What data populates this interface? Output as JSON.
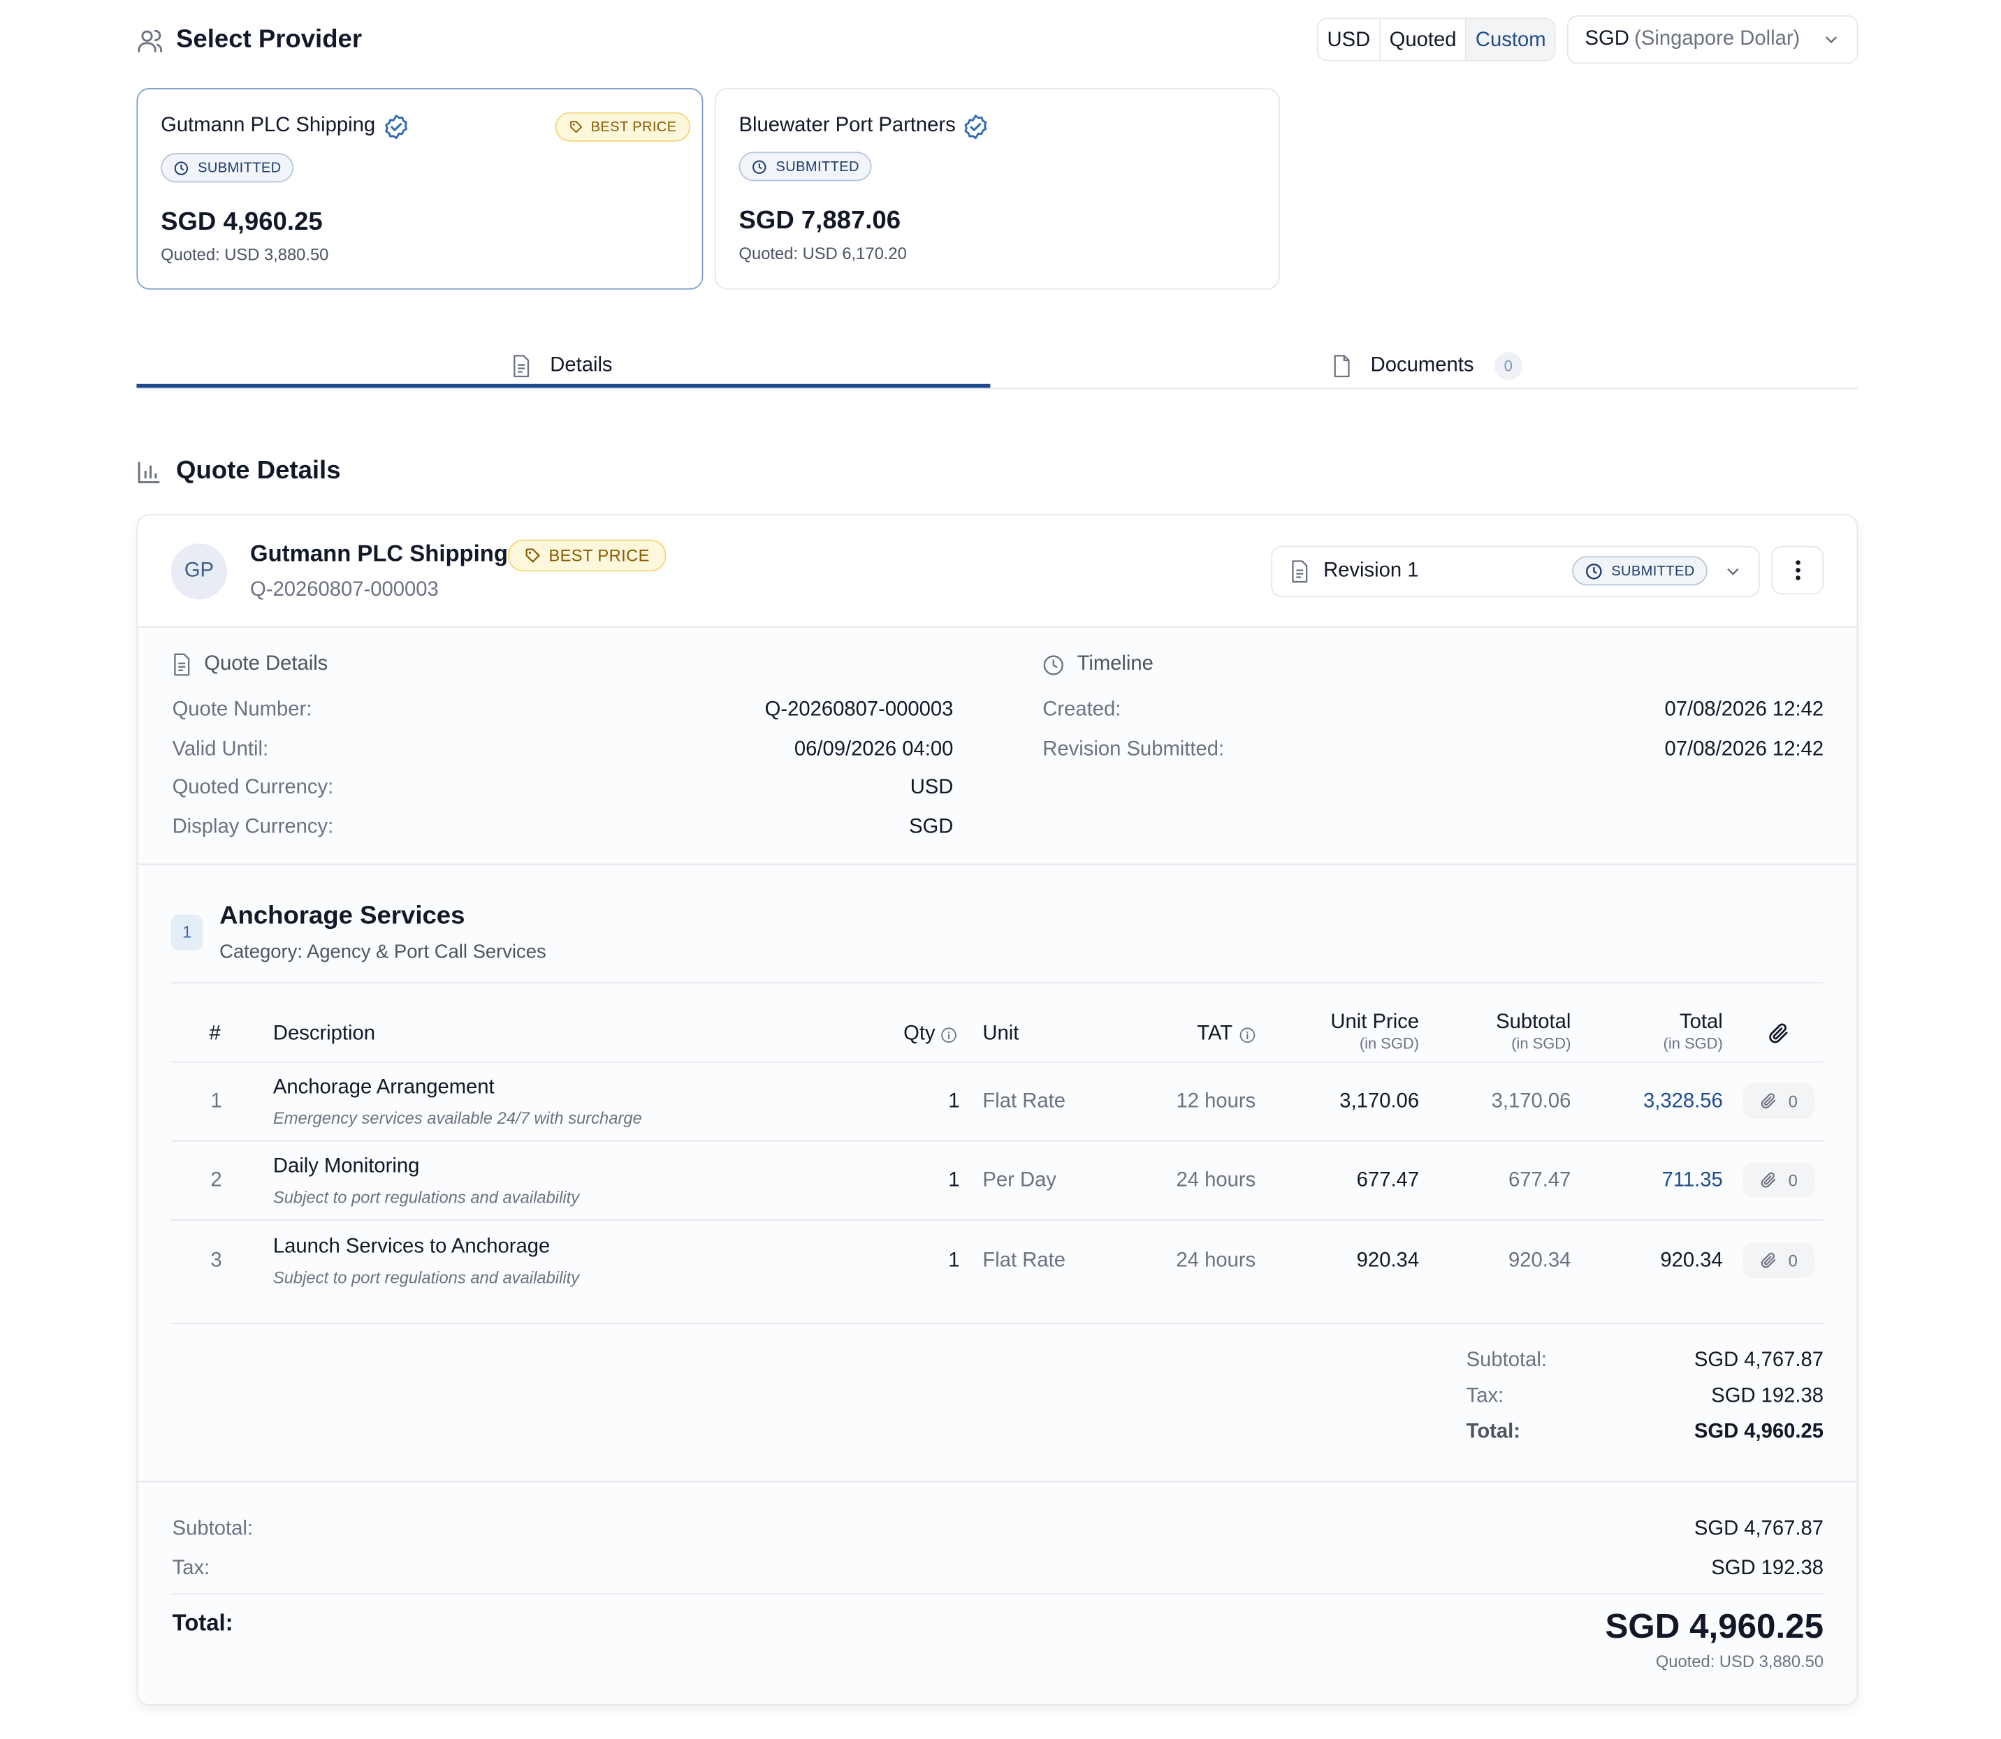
{
  "header": {
    "title": "Select Provider",
    "currency_modes": [
      "USD",
      "Quoted",
      "Custom"
    ],
    "currency_code": "SGD",
    "currency_name": "(Singapore Dollar)"
  },
  "providers": [
    {
      "name": "Gutmann PLC Shipping",
      "status": "SUBMITTED",
      "badge": "BEST PRICE",
      "amount": "SGD 4,960.25",
      "quoted": "Quoted: USD 3,880.50"
    },
    {
      "name": "Bluewater Port Partners",
      "status": "SUBMITTED",
      "amount": "SGD 7,887.06",
      "quoted": "Quoted: USD 6,170.20"
    }
  ],
  "tabs": [
    {
      "label": "Details"
    },
    {
      "label": "Documents",
      "count": "0"
    }
  ],
  "section_title": "Quote Details",
  "quote": {
    "avatar": "GP",
    "provider_name": "Gutmann PLC Shipping",
    "badge": "BEST PRICE",
    "number": "Q-20260807-000003",
    "revision": "Revision 1",
    "revision_status": "SUBMITTED",
    "details": {
      "heading": "Quote Details",
      "rows": [
        {
          "label": "Quote Number:",
          "value": "Q-20260807-000003"
        },
        {
          "label": "Valid Until:",
          "value": "06/09/2026 04:00"
        },
        {
          "label": "Quoted Currency:",
          "value": "USD"
        },
        {
          "label": "Display Currency:",
          "value": "SGD"
        }
      ]
    },
    "timeline": {
      "heading": "Timeline",
      "rows": [
        {
          "label": "Created:",
          "value": "07/08/2026 12:42"
        },
        {
          "label": "Revision Submitted:",
          "value": "07/08/2026 12:42"
        }
      ]
    },
    "service": {
      "index": "1",
      "title": "Anchorage Services",
      "category": "Category: Agency & Port Call Services",
      "columns": {
        "num": "#",
        "desc": "Description",
        "qty": "Qty",
        "unit": "Unit",
        "tat": "TAT",
        "unit_price": "Unit Price",
        "subtotal": "Subtotal",
        "total": "Total",
        "in_sgd": "(in SGD)"
      },
      "rows": [
        {
          "num": "1",
          "title": "Anchorage Arrangement",
          "note": "Emergency services available 24/7 with surcharge",
          "qty": "1",
          "unit": "Flat Rate",
          "tat": "12 hours",
          "unit_price": "3,170.06",
          "subtotal": "3,170.06",
          "total": "3,328.56",
          "attachments": "0"
        },
        {
          "num": "2",
          "title": "Daily Monitoring",
          "note": "Subject to port regulations and availability",
          "qty": "1",
          "unit": "Per Day",
          "tat": "24 hours",
          "unit_price": "677.47",
          "subtotal": "677.47",
          "total": "711.35",
          "attachments": "0"
        },
        {
          "num": "3",
          "title": "Launch Services to Anchorage",
          "note": "Subject to port regulations and availability",
          "qty": "1",
          "unit": "Flat Rate",
          "tat": "24 hours",
          "unit_price": "920.34",
          "subtotal": "920.34",
          "total": "920.34",
          "attachments": "0"
        }
      ],
      "summary": [
        {
          "label": "Subtotal:",
          "value": "SGD 4,767.87"
        },
        {
          "label": "Tax:",
          "value": "SGD 192.38"
        },
        {
          "label": "Total:",
          "value": "SGD 4,960.25"
        }
      ]
    },
    "grand": {
      "subtotal_label": "Subtotal:",
      "subtotal": "SGD 4,767.87",
      "tax_label": "Tax:",
      "tax": "SGD 192.38",
      "total_label": "Total:",
      "total": "SGD 4,960.25",
      "quoted": "Quoted: USD 3,880.50"
    }
  },
  "colors": {
    "accent": "#1e4b8c",
    "verify": "#2f6bb3",
    "best_bg": "#fdf7dc",
    "best_border": "#f3d77a",
    "best_text": "#8a5a00"
  }
}
